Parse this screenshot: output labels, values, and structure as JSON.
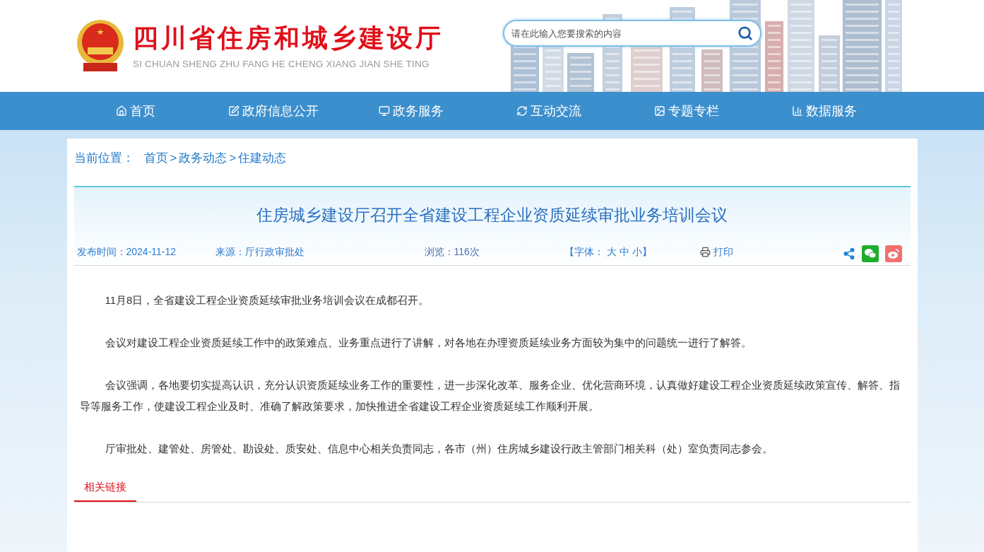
{
  "header": {
    "title": "四川省住房和城乡建设厅",
    "subtitle": "SI CHUAN SHENG ZHU FANG HE CHENG XIANG JIAN SHE TING",
    "search": {
      "placeholder": "请在此输入您要搜索的内容"
    }
  },
  "nav": [
    {
      "label": "首页"
    },
    {
      "label": "政府信息公开"
    },
    {
      "label": "政务服务"
    },
    {
      "label": "互动交流"
    },
    {
      "label": "专题专栏"
    },
    {
      "label": "数据服务"
    }
  ],
  "breadcrumb": {
    "label": "当前位置：",
    "items": [
      "首页",
      "政务动态",
      "住建动态"
    ],
    "separator": ">"
  },
  "article": {
    "title": "住房城乡建设厅召开全省建设工程企业资质延续审批业务培训会议",
    "meta": {
      "published": "发布时间：2024-11-12",
      "source": "来源：厅行政审批处",
      "views": "浏览：116次",
      "font_prefix": "【字体：",
      "font_sizes": [
        "大",
        "中",
        "小"
      ],
      "font_suffix": "】",
      "print": "打印"
    },
    "paragraphs": [
      "11月8日，全省建设工程企业资质延续审批业务培训会议在成都召开。",
      "会议对建设工程企业资质延续工作中的政策难点、业务重点进行了讲解，对各地在办理资质延续业务方面较为集中的问题统一进行了解答。",
      "会议强调，各地要切实提高认识，充分认识资质延续业务工作的重要性，进一步深化改革、服务企业、优化营商环境，认真做好建设工程企业资质延续政策宣传、解答、指导等服务工作，使建设工程企业及时、准确了解政策要求，加快推进全省建设工程企业资质延续工作顺利开展。",
      "厅审批处、建管处、房管处、勘设处、质安处、信息中心相关负责同志，各市（州）住房城乡建设行政主管部门相关科（处）室负责同志参会。"
    ]
  },
  "related_tabs": [
    {
      "label": "相关链接",
      "selected": true
    }
  ]
}
